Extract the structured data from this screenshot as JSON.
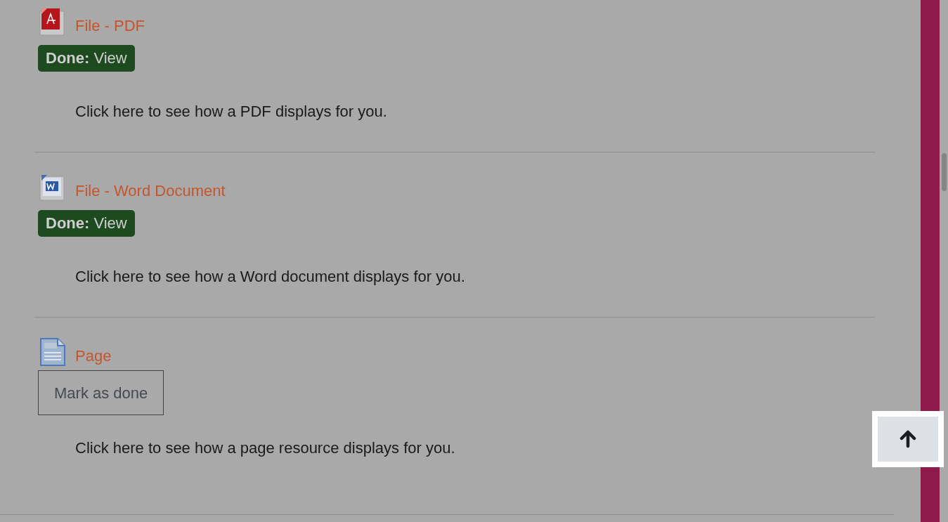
{
  "activities": [
    {
      "kind": "pdf",
      "title": "File - PDF",
      "completion": {
        "kind": "done",
        "label": "**Done:** View"
      },
      "description": "Click here to see how a PDF displays for you."
    },
    {
      "kind": "word",
      "title": "File - Word Document",
      "completion": {
        "kind": "done",
        "label": "**Done:** View"
      },
      "description": "Click here to see how a Word document displays for you."
    },
    {
      "kind": "page",
      "title": "Page",
      "completion": {
        "kind": "manual",
        "label": "Mark as done"
      },
      "description": "Click here to see how a page resource displays for you."
    }
  ]
}
